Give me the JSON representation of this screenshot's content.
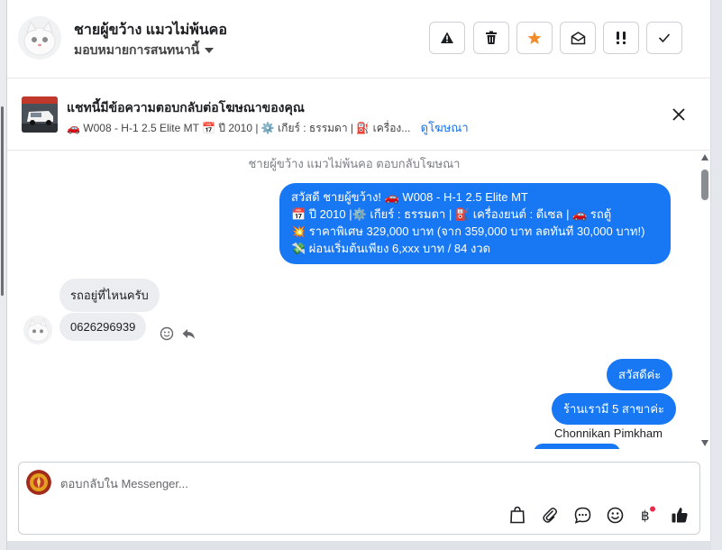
{
  "header": {
    "name": "ชายผู้ขว้าง แมวไม่พ้นคอ",
    "assign_label": "มอบหมายการสนทนานี้",
    "buttons": [
      "warning-button",
      "delete-button",
      "star-button",
      "mark-unread-button",
      "important-button",
      "done-button"
    ]
  },
  "ad": {
    "title": "แชทนี้มีข้อความตอบกลับต่อโฆษณาของคุณ",
    "subtitle": "🚗 W008 - H-1 2.5 Elite MT 📅 ปี 2010 | ⚙️ เกียร์ : ธรรมดา | ⛽ เครื่อง...",
    "link": "ดูโฆษณา"
  },
  "chat": {
    "system_text": "ชายผู้ขว้าง แมวไม่พ้นคอ ตอบกลับโฆษณา",
    "outgoing_ad_lines": [
      "สวัสดี ชายผู้ขว้าง! 🚗 W008 - H-1 2.5 Elite MT",
      "📅 ปี 2010 |⚙️ เกียร์ : ธรรมดา | ⛽ เครื่องยนต์ : ดีเซล | 🚗 รถตู้",
      "💥 ราคาพิเศษ 329,000 บาท (จาก 359,000 บาท ลดทันที 30,000 บาท!)",
      "💸 ผ่อนเริ่มต้นเพียง 6,xxx บาท / 84 งวด"
    ],
    "incoming": [
      "รถอยู่ที่ไหนครับ",
      "0626296939"
    ],
    "outgoing_short": [
      "สวัสดีค่ะ",
      "ร้านเรามี 5 สาขาค่ะ"
    ],
    "sender_name": "Chonnikan Pimkham"
  },
  "composer": {
    "placeholder": "ตอบกลับใน Messenger...",
    "tools": [
      "shopping-bag-icon",
      "attachment-icon",
      "saved-reply-icon",
      "emoji-icon",
      "baht-icon",
      "like-icon"
    ]
  },
  "colors": {
    "accent": "#1877f2",
    "star": "#f28c28",
    "notify_dot": "#f0284a"
  }
}
